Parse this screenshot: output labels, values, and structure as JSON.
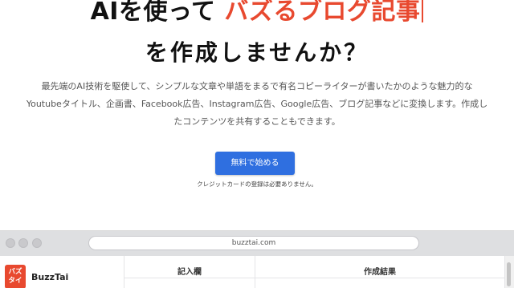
{
  "hero": {
    "title_prefix": "AIを使って",
    "title_accent": "バズるブログ記事",
    "title_line2": "を作成しませんか？",
    "accent_color": "#e8492f"
  },
  "description": {
    "line1": "最先端のAI技術を駆使して、シンプルな文章や単語をまるで有名コピーライターが書いたかのような魅力的な",
    "line2": "Youtubeタイトル、企画書、Facebook広告、Instagram広告、Google広告、ブログ記事などに変換します。作成し",
    "line3": "たコンテンツを共有することもできます。"
  },
  "cta": {
    "button_label": "無料で始める",
    "note": "クレジットカードの登録は必要ありません。",
    "button_color": "#2f6fe0"
  },
  "browser": {
    "url": "buzztai.com"
  },
  "app": {
    "logo_line1": "バズ",
    "logo_line2": "タイ",
    "brand_name": "BuzzTai",
    "columns": {
      "input_header": "記入欄",
      "result_header": "作成結果"
    }
  }
}
